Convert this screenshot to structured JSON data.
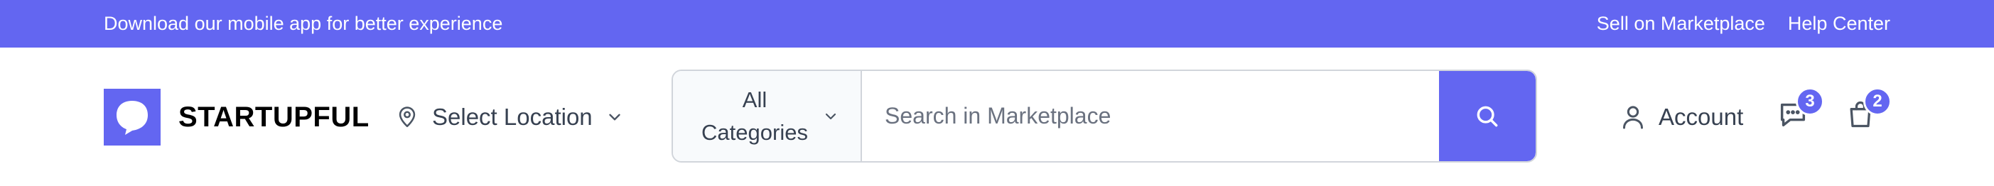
{
  "topbar": {
    "promo_text": "Download our mobile app for better experience",
    "links": [
      "Sell on Marketplace",
      "Help Center"
    ]
  },
  "header": {
    "brand": "STARTUPFUL",
    "location_label": "Select Location",
    "search": {
      "category_label": "All Categories",
      "placeholder": "Search in Marketplace"
    },
    "account_label": "Account",
    "messages_count": "3",
    "cart_count": "2"
  },
  "icons": {
    "logo": "chat-bubble-logo-icon",
    "location": "map-pin-icon",
    "location_dropdown": "chevron-down-icon",
    "category_dropdown": "chevron-down-icon",
    "search": "search-icon",
    "account": "user-icon",
    "messages": "message-dots-icon",
    "cart": "shopping-bag-icon"
  },
  "colors": {
    "accent": "#6366f1",
    "text": "#374151",
    "muted": "#6b7280",
    "border": "#d1d5db"
  }
}
